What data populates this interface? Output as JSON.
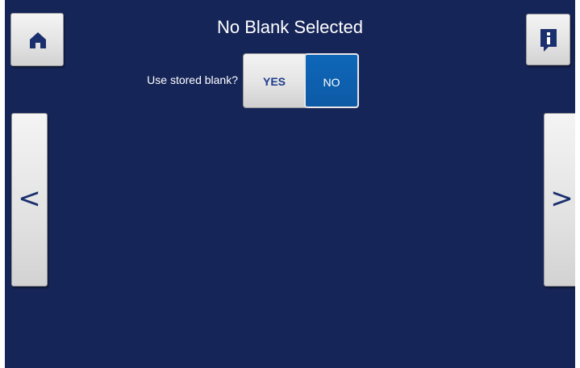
{
  "screen": {
    "title": "No Blank Selected"
  },
  "blank_option": {
    "prompt": "Use stored blank?",
    "yes_label": "YES",
    "no_label": "NO",
    "selected": "NO"
  },
  "navigation": {
    "previous_label": "<",
    "next_label": ">"
  },
  "icons": {
    "home": "home-icon",
    "info": "info-icon"
  },
  "colors": {
    "background": "#162558",
    "selected_segment": "#0d5aa6",
    "button_face": "#e2e2e2",
    "icon": "#1a2f6e"
  }
}
